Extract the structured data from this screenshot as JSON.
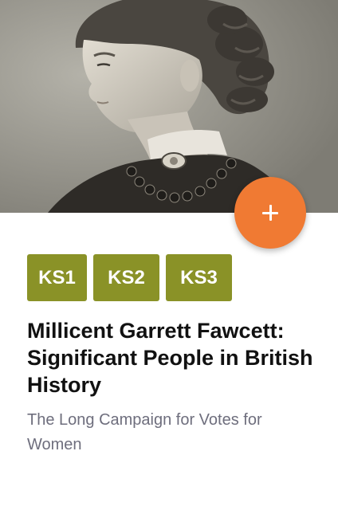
{
  "card": {
    "image": "portrait-photo",
    "add_button_icon": "plus-icon",
    "accent_color": "#f07a33",
    "tag_color": "#8a9227",
    "tags": [
      {
        "label": "KS1"
      },
      {
        "label": "KS2"
      },
      {
        "label": "KS3"
      }
    ],
    "title": "Millicent Garrett Fawcett: Significant People in British History",
    "subtitle": "The Long Campaign for Votes for Women"
  }
}
